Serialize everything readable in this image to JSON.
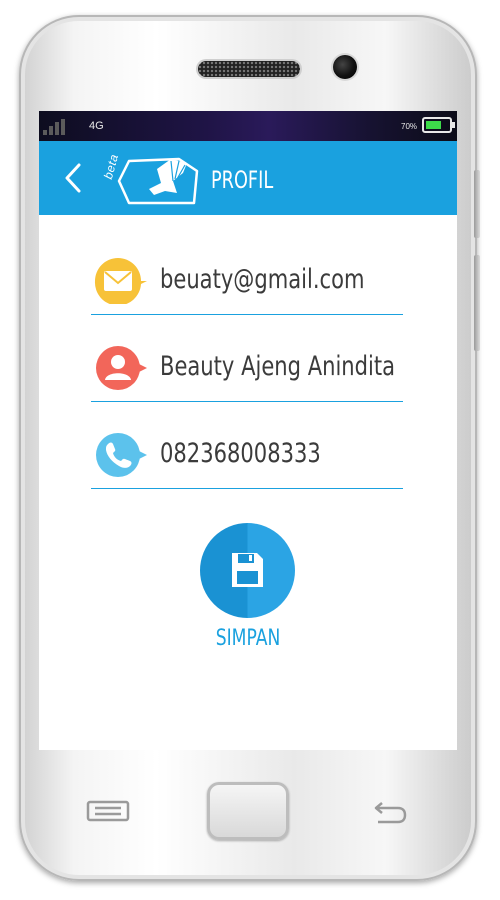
{
  "status_bar": {
    "network": "4G",
    "battery_percent_text": "70%",
    "battery_level": 0.7,
    "signal_icon": "signal-bars-icon",
    "battery_color": "#3ddc4a"
  },
  "app_bar": {
    "title": "PROFIL",
    "logo_badge": "beta",
    "back_icon": "chevron-left-icon",
    "background_color": "#1aa1df"
  },
  "profile": {
    "email": {
      "value": "beuaty@gmail.com",
      "icon": "mail-icon",
      "icon_color": "#f7c238"
    },
    "name": {
      "value": "Beauty Ajeng Anindita",
      "icon": "user-icon",
      "icon_color": "#f2665a"
    },
    "phone": {
      "value": "082368008333",
      "icon": "phone-icon",
      "icon_color": "#5cc2ec"
    }
  },
  "save_button": {
    "label": "SIMPAN",
    "icon": "save-icon",
    "color": "#1a92d3"
  },
  "hardware_buttons": {
    "menu_icon": "menu-icon",
    "home": "home-button",
    "back_icon": "back-arrow-icon"
  }
}
